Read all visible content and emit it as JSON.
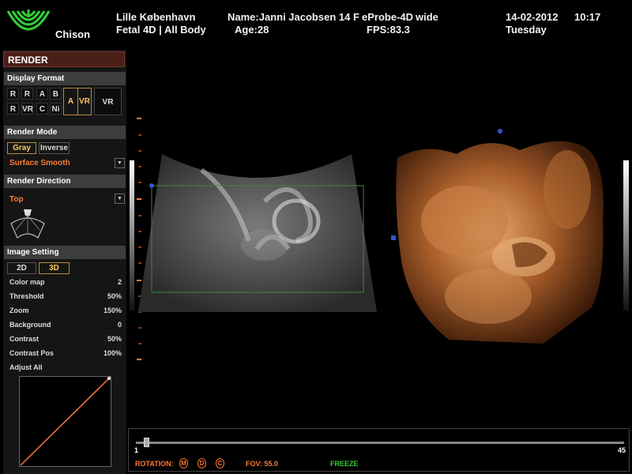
{
  "header": {
    "brand": "Chison",
    "hospital": "Lille København",
    "patient_name": "Name:Janni Jacobsen 14 F",
    "exam": "Fetal 4D | All Body",
    "age": "Age:28",
    "probe": "eProbe-4D",
    "probe_mode": "wide",
    "fps": "FPS:83.3",
    "date": "14-02-2012",
    "time": "10:17",
    "weekday": "Tuesday"
  },
  "panel": {
    "title": "RENDER",
    "display_format": {
      "heading": "Display Format",
      "grid": [
        [
          "R",
          "R",
          "A",
          "B"
        ],
        [
          "R",
          "VR",
          "C",
          "Ni"
        ]
      ],
      "a_label": "A",
      "vr_label": "VR",
      "vr_big": "VR"
    },
    "render_mode": {
      "heading": "Render Mode",
      "gray": "Gray",
      "inverse": "Inverse",
      "mode": "Surface Smooth"
    },
    "render_direction": {
      "heading": "Render Direction",
      "direction": "Top"
    },
    "image_setting": {
      "heading": "Image Setting",
      "tab_2d": "2D",
      "tab_3d": "3D",
      "rows": [
        {
          "label": "Color map",
          "value": "2"
        },
        {
          "label": "Threshold",
          "value": "50%"
        },
        {
          "label": "Zoom",
          "value": "150%"
        },
        {
          "label": "Background",
          "value": "0"
        },
        {
          "label": "Contrast",
          "value": "50%"
        },
        {
          "label": "Contrast Pos",
          "value": "100%"
        }
      ],
      "adjust_all": "Adjust All"
    }
  },
  "footer": {
    "slider_min": "1",
    "slider_max": "45",
    "slider_position": 1,
    "rotation_label": "ROTATION:",
    "rot_icons": [
      "M",
      "D",
      "C"
    ],
    "fov": "FOV: 55.0",
    "freeze": "FREEZE"
  },
  "colors": {
    "accent_orange": "#ff7a33",
    "freeze_green": "#33cc33",
    "render_header": "#4a1f18"
  }
}
